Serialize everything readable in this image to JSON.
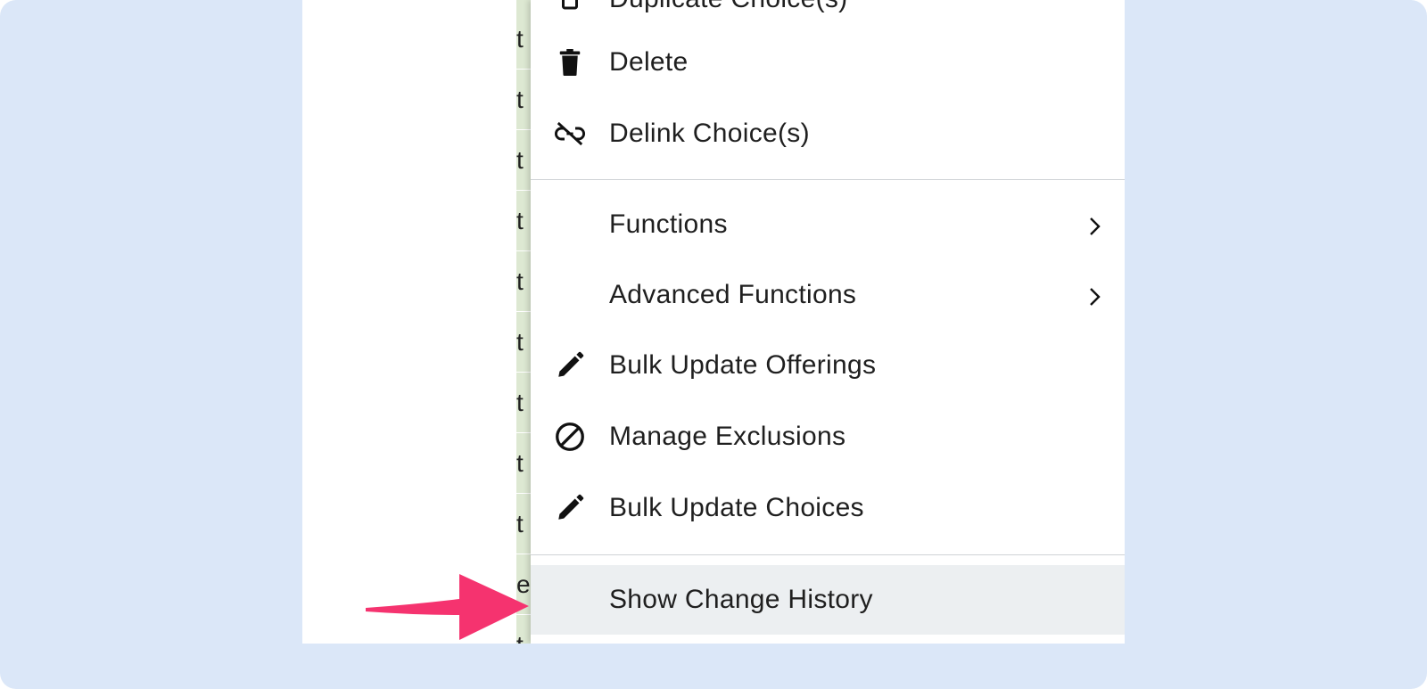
{
  "colors": {
    "page_background": "#dbe7f8",
    "highlight_arrow": "#f5336f",
    "active_row": "#eceff1"
  },
  "grid": {
    "cells": [
      "t",
      "t",
      "t",
      "t",
      "t",
      "t",
      "t",
      "t",
      "t",
      "t",
      "e",
      "t"
    ]
  },
  "menu": {
    "items": [
      {
        "label": "Duplicate Choice(s)",
        "icon": "duplicate-icon"
      },
      {
        "label": "Delete",
        "icon": "trash-icon"
      },
      {
        "label": "Delink Choice(s)",
        "icon": "unlink-icon"
      },
      {
        "label": "Functions",
        "icon": "chevron-right-icon"
      },
      {
        "label": "Advanced Functions",
        "icon": "chevron-right-icon"
      },
      {
        "label": "Bulk Update Offerings",
        "icon": "pencil-icon"
      },
      {
        "label": "Manage Exclusions",
        "icon": "block-icon"
      },
      {
        "label": "Bulk Update Choices",
        "icon": "pencil-icon"
      },
      {
        "label": "Show Change History",
        "icon": ""
      }
    ]
  },
  "annotation": {
    "arrow_target": "Show Change History"
  }
}
